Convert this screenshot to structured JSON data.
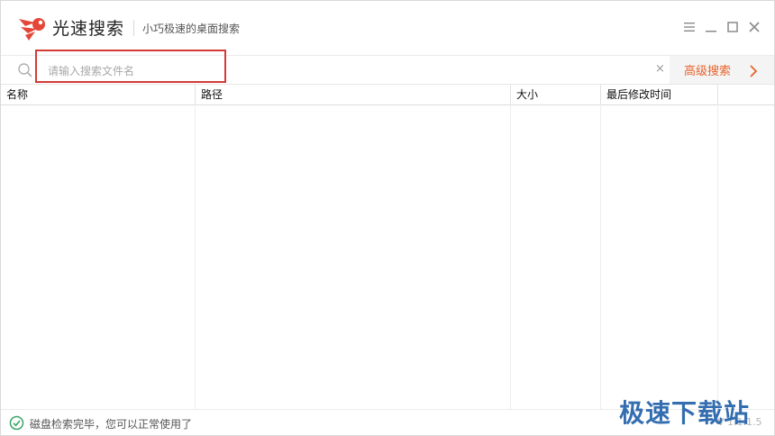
{
  "titlebar": {
    "app_name": "光速搜索",
    "tagline": "小巧极速的桌面搜索"
  },
  "search": {
    "placeholder": "请输入搜索文件名",
    "value": "",
    "clear_label": "×",
    "advanced_label": "高级搜索"
  },
  "table": {
    "columns": [
      {
        "label": "名称"
      },
      {
        "label": "路径"
      },
      {
        "label": "大小"
      },
      {
        "label": "最后修改时间"
      }
    ],
    "rows": []
  },
  "status": {
    "text": "磁盘检索完毕，您可以正常使用了",
    "version": "V 1.1.1.5"
  },
  "watermark": "极速下载站",
  "colors": {
    "accent": "#e8632c",
    "highlight": "#d23b37",
    "watermark": "#1f5fa8",
    "ok": "#3aa56a"
  }
}
